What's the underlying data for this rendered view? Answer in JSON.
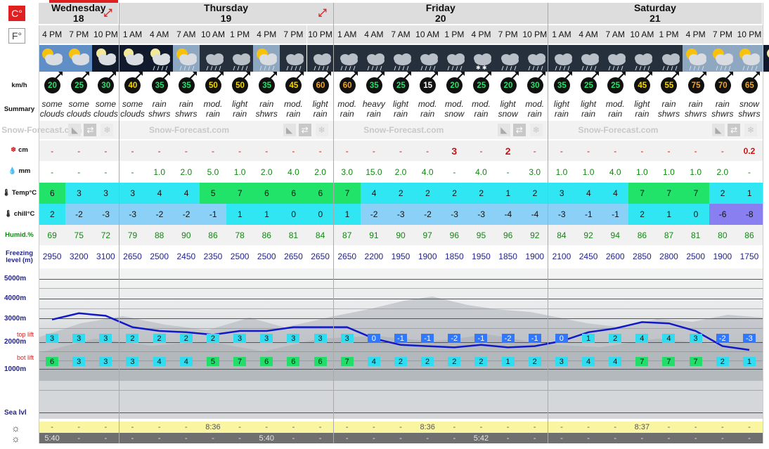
{
  "units": {
    "celsius": "C°",
    "fahrenheit": "F°"
  },
  "days": [
    {
      "name": "Wednesday",
      "date": "18",
      "times": [
        "4 PM",
        "7 PM",
        "10 PM"
      ]
    },
    {
      "name": "Thursday",
      "date": "19",
      "times": [
        "1 AM",
        "4 AM",
        "7 AM",
        "10 AM",
        "1 PM",
        "4 PM",
        "7 PM",
        "10 PM"
      ]
    },
    {
      "name": "Friday",
      "date": "20",
      "times": [
        "1 AM",
        "4 AM",
        "7 AM",
        "10 AM",
        "1 PM",
        "4 PM",
        "7 PM",
        "10 PM"
      ]
    },
    {
      "name": "Saturday",
      "date": "21",
      "times": [
        "1 AM",
        "4 AM",
        "7 AM",
        "10 AM",
        "1 PM",
        "4 PM",
        "7 PM",
        "10 PM"
      ]
    }
  ],
  "labels": {
    "wind": "km/h",
    "summary": "Summary",
    "snow": "cm",
    "rain": "mm",
    "temp": "Temp°C",
    "chill": "chill°C",
    "humid": "Humid.%",
    "freezing": "Freezing level (m)",
    "top_lift": "top lift",
    "bot_lift": "bot lift",
    "sea_level": "Sea lvl"
  },
  "watermark": "Snow-Forecast.com",
  "icons": [
    "sun-clouds",
    "sun-clouds",
    "moon-clouds",
    "moon-clouds",
    "night-rain",
    "sun-rain",
    "rain",
    "rain",
    "sun-rain",
    "rain",
    "rain",
    "rain",
    "rain",
    "rain",
    "rain",
    "rain",
    "snow",
    "rain",
    "rain",
    "rain",
    "rain",
    "rain",
    "rain",
    "rain",
    "sun-rain",
    "sun-rain",
    "sun-rain",
    "night-snow"
  ],
  "wind": [
    20,
    25,
    30,
    40,
    35,
    35,
    50,
    50,
    35,
    45,
    60,
    60,
    35,
    25,
    15,
    20,
    25,
    20,
    30,
    35,
    25,
    25,
    45,
    55,
    75,
    70,
    65
  ],
  "wind_colors": [
    "green",
    "green",
    "green",
    "yellow",
    "green",
    "green",
    "yellow",
    "yellow",
    "green",
    "yellow",
    "orange",
    "orange",
    "green",
    "green",
    "white",
    "green",
    "green",
    "green",
    "green",
    "green",
    "green",
    "green",
    "yellow",
    "yellow",
    "orange",
    "orange",
    "orange"
  ],
  "summary": [
    [
      "some",
      "clouds"
    ],
    [
      "some",
      "clouds"
    ],
    [
      "some",
      "clouds"
    ],
    [
      "some",
      "clouds"
    ],
    [
      "rain",
      "shwrs"
    ],
    [
      "rain",
      "shwrs"
    ],
    [
      "mod.",
      "rain"
    ],
    [
      "light",
      "rain"
    ],
    [
      "rain",
      "shwrs"
    ],
    [
      "mod.",
      "rain"
    ],
    [
      "light",
      "rain"
    ],
    [
      "mod.",
      "rain"
    ],
    [
      "heavy",
      "rain"
    ],
    [
      "light",
      "rain"
    ],
    [
      "mod.",
      "rain"
    ],
    [
      "mod.",
      "snow"
    ],
    [
      "mod.",
      "rain"
    ],
    [
      "light",
      "snow"
    ],
    [
      "mod.",
      "rain"
    ],
    [
      "light",
      "rain"
    ],
    [
      "light",
      "rain"
    ],
    [
      "mod.",
      "rain"
    ],
    [
      "light",
      "rain"
    ],
    [
      "rain",
      "shwrs"
    ],
    [
      "rain",
      "shwrs"
    ],
    [
      "rain",
      "shwrs"
    ],
    [
      "snow",
      "shwrs"
    ]
  ],
  "snow": [
    "-",
    "-",
    "-",
    "-",
    "-",
    "-",
    "-",
    "-",
    "-",
    "-",
    "-",
    "-",
    "-",
    "-",
    "-",
    "3",
    "-",
    "2",
    "-",
    "-",
    "-",
    "-",
    "-",
    "-",
    "-",
    "-",
    "0.2"
  ],
  "rain": [
    "-",
    "-",
    "-",
    "-",
    "1.0",
    "2.0",
    "5.0",
    "1.0",
    "2.0",
    "4.0",
    "2.0",
    "3.0",
    "15.0",
    "2.0",
    "4.0",
    "-",
    "4.0",
    "-",
    "3.0",
    "1.0",
    "1.0",
    "4.0",
    "1.0",
    "1.0",
    "1.0",
    "2.0",
    "-"
  ],
  "temp": [
    "6",
    "3",
    "3",
    "3",
    "4",
    "4",
    "5",
    "7",
    "6",
    "6",
    "6",
    "7",
    "4",
    "2",
    "2",
    "2",
    "2",
    "1",
    "2",
    "3",
    "4",
    "4",
    "7",
    "7",
    "7",
    "2",
    "1"
  ],
  "chill": [
    "2",
    "-2",
    "-3",
    "-3",
    "-2",
    "-2",
    "-1",
    "1",
    "1",
    "0",
    "0",
    "1",
    "-2",
    "-3",
    "-2",
    "-3",
    "-3",
    "-4",
    "-4",
    "-3",
    "-1",
    "-1",
    "2",
    "1",
    "0",
    "-6",
    "-8"
  ],
  "humid": [
    "69",
    "75",
    "72",
    "79",
    "88",
    "90",
    "86",
    "78",
    "86",
    "81",
    "84",
    "87",
    "91",
    "90",
    "97",
    "96",
    "95",
    "96",
    "92",
    "84",
    "92",
    "94",
    "86",
    "87",
    "81",
    "80",
    "86"
  ],
  "freezing": [
    "2950",
    "3200",
    "3100",
    "2650",
    "2500",
    "2450",
    "2350",
    "2500",
    "2500",
    "2650",
    "2650",
    "2650",
    "2200",
    "1950",
    "1900",
    "1850",
    "1950",
    "1850",
    "1900",
    "2100",
    "2450",
    "2600",
    "2850",
    "2800",
    "2500",
    "1900",
    "1750"
  ],
  "altitudes": [
    "5000m",
    "4000m",
    "3000m",
    "2000m",
    "1000m"
  ],
  "top_lift": [
    "3",
    "3",
    "3",
    "2",
    "2",
    "2",
    "2",
    "3",
    "3",
    "3",
    "3",
    "3",
    "0",
    "-1",
    "-1",
    "-2",
    "-1",
    "-2",
    "-1",
    "0",
    "1",
    "2",
    "4",
    "4",
    "3",
    "-2",
    "-3"
  ],
  "bot_lift": [
    "6",
    "3",
    "3",
    "3",
    "4",
    "4",
    "5",
    "7",
    "6",
    "6",
    "6",
    "7",
    "4",
    "2",
    "2",
    "2",
    "2",
    "1",
    "2",
    "3",
    "4",
    "4",
    "7",
    "7",
    "7",
    "2",
    "1"
  ],
  "sunrise": [
    "-",
    "-",
    "-",
    "-",
    "-",
    "-",
    "8:36",
    "-",
    "-",
    "-",
    "-",
    "-",
    "-",
    "-",
    "8:36",
    "-",
    "-",
    "-",
    "-",
    "-",
    "-",
    "-",
    "8:37",
    "-",
    "-",
    "-",
    "-"
  ],
  "sunset": [
    "5:40",
    "-",
    "-",
    "-",
    "-",
    "-",
    "-",
    "-",
    "5:40",
    "-",
    "-",
    "-",
    "-",
    "-",
    "-",
    "-",
    "5:42",
    "-",
    "-",
    "-",
    "-",
    "-",
    "-",
    "-",
    "-",
    "-",
    "-"
  ],
  "colors": {
    "temp_green": "#22e36a",
    "temp_cyan": "#2fe6f2",
    "chill_blue": "#8bd0f7",
    "chill_purple": "#8a7ff0",
    "snow_red": "#cc1111",
    "rain_green": "#118811"
  }
}
